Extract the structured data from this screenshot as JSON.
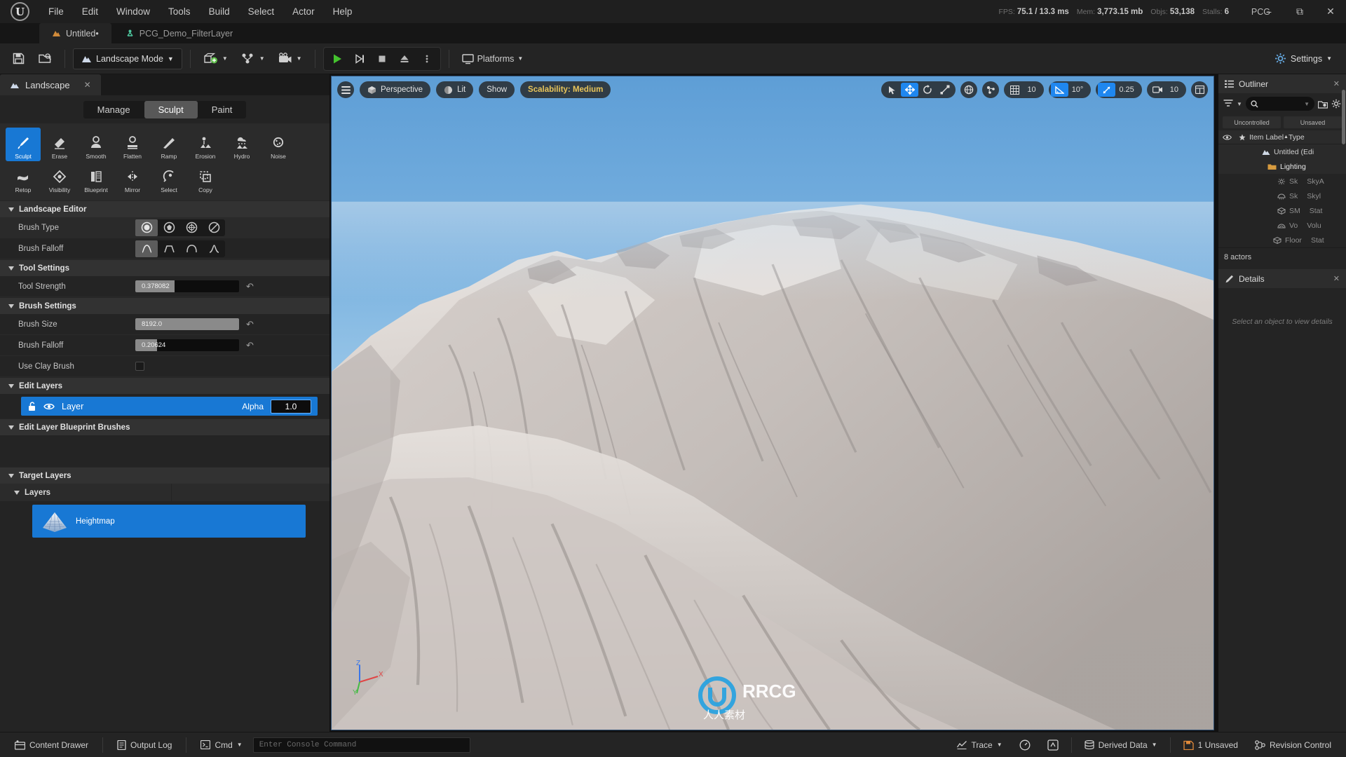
{
  "titlebar": {
    "menus": [
      "File",
      "Edit",
      "Window",
      "Tools",
      "Build",
      "Select",
      "Actor",
      "Help"
    ],
    "stats": {
      "fps_label": "FPS:",
      "fps_value": "75.1",
      "ms_value": "/ 13.3 ms",
      "mem_label": "Mem:",
      "mem_value": "3,773.15 mb",
      "obj_label": "Objs:",
      "obj_value": "53,138",
      "stalls_label": "Stalls:",
      "stalls_value": "6"
    },
    "project_name": "PCG",
    "window_minimize": "minimize-icon",
    "window_maximize": "maximize-icon",
    "window_close": "close-icon"
  },
  "tabs": [
    {
      "label": "Untitled•",
      "icon": "landscape-icon",
      "active": true
    },
    {
      "label": "PCG_Demo_FilterLayer",
      "icon": "blueprint-icon",
      "active": false
    }
  ],
  "toolbar": {
    "save_icon": "save-icon",
    "browse_icon": "browse-content-icon",
    "mode_label": "Landscape Mode",
    "add_label": "add-actor-icon",
    "blueprint_label": "blueprints-icon",
    "cinematics_label": "cinematics-icon",
    "play_icon": "play-icon",
    "skip_icon": "step-icon",
    "stop_icon": "stop-icon",
    "eject_icon": "eject-icon",
    "more_icon": "more-options-icon",
    "platforms_label": "Platforms",
    "settings_label": "Settings"
  },
  "left_panel": {
    "tab_label": "Landscape",
    "tab_icon": "landscape-icon",
    "modes": [
      {
        "label": "Manage",
        "active": false
      },
      {
        "label": "Sculpt",
        "active": true
      },
      {
        "label": "Paint",
        "active": false
      }
    ],
    "tools_row1": [
      {
        "label": "Sculpt",
        "active": true
      },
      {
        "label": "Erase",
        "active": false
      },
      {
        "label": "Smooth",
        "active": false
      },
      {
        "label": "Flatten",
        "active": false
      },
      {
        "label": "Ramp",
        "active": false
      },
      {
        "label": "Erosion",
        "active": false
      },
      {
        "label": "Hydro",
        "active": false
      },
      {
        "label": "Noise",
        "active": false
      }
    ],
    "tools_row2": [
      {
        "label": "Retop",
        "active": false
      },
      {
        "label": "Visibility",
        "active": false
      },
      {
        "label": "Blueprint",
        "active": false
      },
      {
        "label": "Mirror",
        "active": false
      },
      {
        "label": "Select",
        "active": false
      },
      {
        "label": "Copy",
        "active": false
      }
    ],
    "sections": {
      "landscape_editor": "Landscape Editor",
      "tool_settings": "Tool Settings",
      "brush_settings": "Brush Settings",
      "edit_layers": "Edit Layers",
      "edit_layer_bp_brushes": "Edit Layer Blueprint Brushes",
      "target_layers": "Target Layers",
      "layers": "Layers"
    },
    "props": {
      "brush_type_label": "Brush Type",
      "brush_falloff_shape_label": "Brush Falloff",
      "tool_strength_label": "Tool Strength",
      "tool_strength_value": "0.378082",
      "tool_strength_fill_pct": 38,
      "brush_size_label": "Brush Size",
      "brush_size_value": "8192.0",
      "brush_size_fill_pct": 100,
      "brush_falloff_label": "Brush Falloff",
      "brush_falloff_value": "0.20624",
      "brush_falloff_fill_pct": 21,
      "use_clay_brush_label": "Use Clay Brush"
    },
    "edit_layer": {
      "name": "Layer",
      "alpha_label": "Alpha",
      "alpha_value": "1.0",
      "lock_icon": "unlock-icon",
      "eye_icon": "eye-icon"
    },
    "target_layer_item": {
      "name": "Heightmap",
      "thumb_icon": "heightmap-thumbnail-icon"
    }
  },
  "viewport": {
    "menu_icon": "viewport-menu-icon",
    "camera_mode": "Perspective",
    "view_mode": "Lit",
    "show_label": "Show",
    "scalability": "Scalability: Medium",
    "transform_tools": [
      {
        "icon": "select-arrow-icon",
        "active": false
      },
      {
        "icon": "move-gizmo-icon",
        "active": true
      },
      {
        "icon": "rotate-gizmo-icon",
        "active": false
      },
      {
        "icon": "scale-gizmo-icon",
        "active": false
      }
    ],
    "coord_icon": "world-coordinate-icon",
    "surface_snap_icon": "surface-snap-icon",
    "grid_snap": {
      "icon": "grid-snap-icon",
      "value": "10",
      "active": false
    },
    "angle_snap": {
      "icon": "angle-snap-icon",
      "value": "10°",
      "active": true
    },
    "scale_snap": {
      "icon": "scale-snap-icon",
      "value": "0.25",
      "active": true
    },
    "camera_speed": {
      "icon": "camera-speed-icon",
      "value": "10",
      "active": false
    },
    "maximize_icon": "viewport-layout-icon",
    "axis_x": "X",
    "axis_y": "Y",
    "axis_z": "Z"
  },
  "right_panel": {
    "outliner": {
      "title": "Outliner",
      "icon": "outliner-icon",
      "search_placeholder": "",
      "filter_icon": "filter-icon",
      "search_icon": "search-icon",
      "save_icon": "save-view-icon",
      "settings_icon": "gear-icon",
      "chips": [
        "Uncontrolled",
        "Unsaved"
      ],
      "columns": [
        "Item Label",
        "Type"
      ],
      "eye_col_icon": "eye-icon",
      "star_col_icon": "star-icon",
      "rows": [
        {
          "label": "Untitled (Edi",
          "type": "",
          "icon": "landscape-icon",
          "indent": 0,
          "dim": false
        },
        {
          "label": "Lighting",
          "type": "",
          "icon": "folder-icon",
          "indent": 1,
          "dim": false
        },
        {
          "label": "Sk",
          "type": "SkyA",
          "icon": "sky-icon",
          "indent": 2,
          "dim": true
        },
        {
          "label": "Sk",
          "type": "Skyl",
          "icon": "skylight-icon",
          "indent": 2,
          "dim": true
        },
        {
          "label": "SM",
          "type": "Stat",
          "icon": "staticmesh-icon",
          "indent": 2,
          "dim": true
        },
        {
          "label": "Vo",
          "type": "Volu",
          "icon": "volume-icon",
          "indent": 2,
          "dim": true
        },
        {
          "label": "Floor",
          "type": "Stat",
          "icon": "staticmesh-icon",
          "indent": 2,
          "dim": true
        }
      ],
      "actor_count": "8 actors"
    },
    "details": {
      "title": "Details",
      "icon": "details-icon",
      "empty_message": "Select an object to view details"
    }
  },
  "statusbar": {
    "content_drawer": "Content Drawer",
    "output_log": "Output Log",
    "cmd_label": "Cmd",
    "console_placeholder": "Enter Console Command",
    "trace_label": "Trace",
    "derived_data_label": "Derived Data",
    "unsaved_label": "1 Unsaved",
    "revision_label": "Revision Control",
    "perf_icon": "performance-icon",
    "tool_icon": "tools-icon"
  },
  "colors": {
    "accent_blue": "#1878d4",
    "highlight_blue": "#1f87ef",
    "warn_yellow": "#e8c45a",
    "panel_bg": "#242424",
    "dark_bg": "#1a1a1a"
  }
}
